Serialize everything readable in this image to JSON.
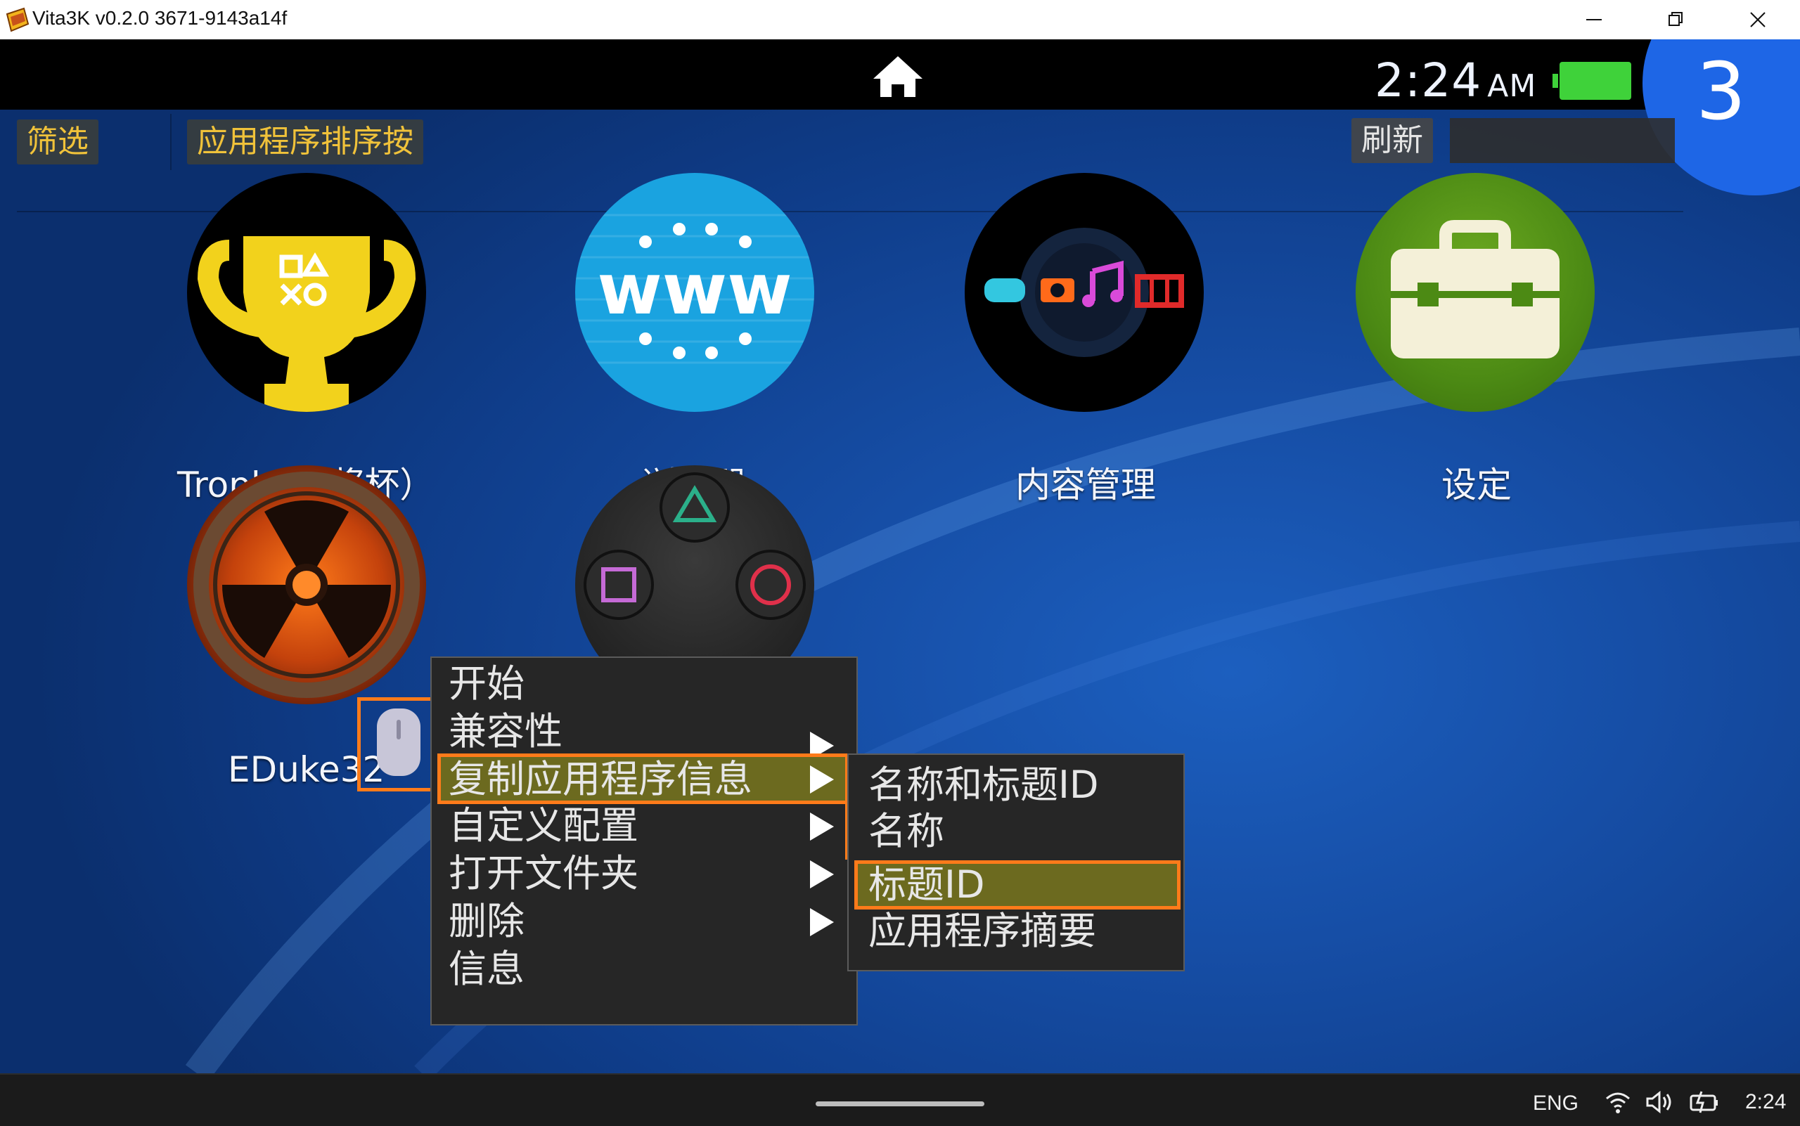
{
  "window": {
    "title": "Vita3K v0.2.0 3671-9143a14f"
  },
  "statusbar": {
    "time": "2:24",
    "ampm": "AM",
    "notification_count": "3"
  },
  "toolbar": {
    "filter_label": "筛选",
    "sort_label": "应用程序排序按",
    "refresh_label": "刷新",
    "search_value": ""
  },
  "apps": [
    {
      "label": "Trophy（奖杯）",
      "icon": "trophy-icon"
    },
    {
      "label": "浏览器",
      "icon": "browser-www-icon"
    },
    {
      "label": "内容管理",
      "icon": "content-manager-icon"
    },
    {
      "label": "设定",
      "icon": "settings-toolbox-icon"
    },
    {
      "label": "EDuke32",
      "icon": "eduke32-icon"
    },
    {
      "label": "",
      "icon": "playstation-buttons-icon"
    }
  ],
  "context_menu": {
    "items": [
      {
        "label": "开始",
        "submenu": false
      },
      {
        "label": "兼容性",
        "submenu": true
      },
      {
        "label": "复制应用程序信息",
        "submenu": true,
        "highlighted": true
      },
      {
        "label": "自定义配置",
        "submenu": true
      },
      {
        "label": "打开文件夹",
        "submenu": true
      },
      {
        "label": "删除",
        "submenu": true
      },
      {
        "label": "信息",
        "submenu": false
      }
    ]
  },
  "submenu": {
    "items": [
      {
        "label": "名称和标题ID"
      },
      {
        "label": "名称"
      },
      {
        "label": "标题ID",
        "highlighted": true
      },
      {
        "label": "应用程序摘要"
      }
    ]
  },
  "taskbar": {
    "language": "ENG",
    "time": "2:24"
  },
  "colors": {
    "accent": "#ff7b1a",
    "highlight": "#6c6a1f",
    "badge": "#1e66e6",
    "battery": "#3fd23a"
  }
}
